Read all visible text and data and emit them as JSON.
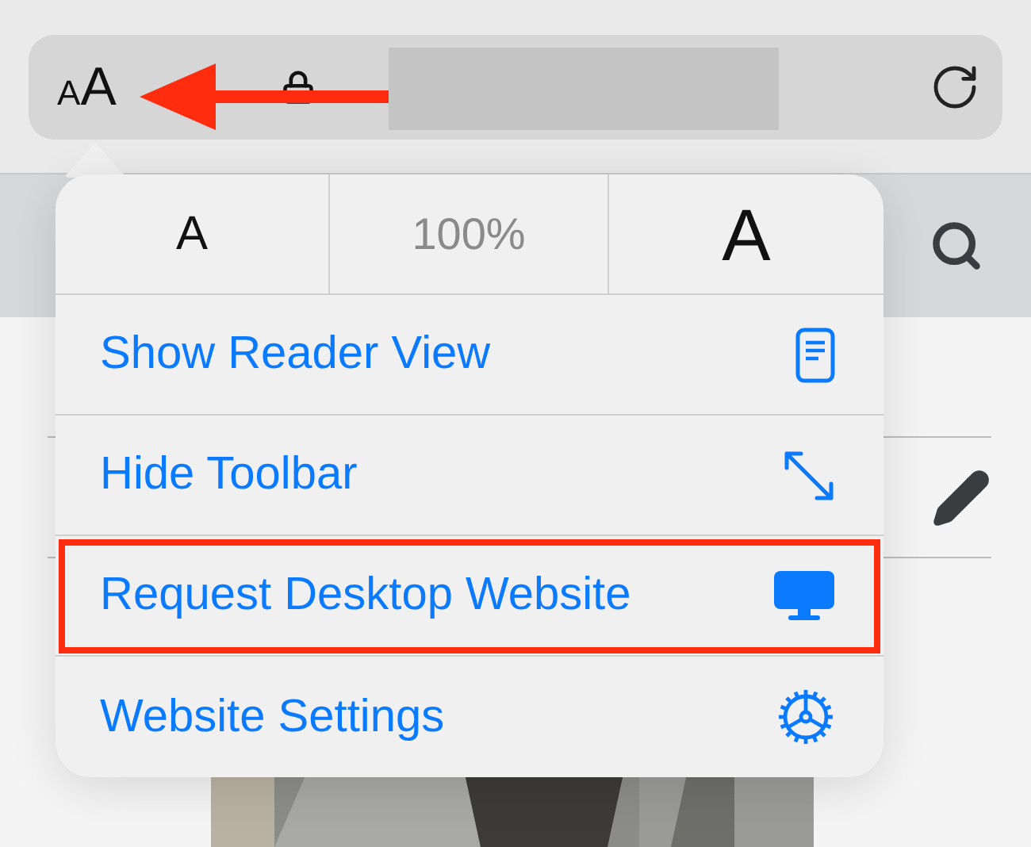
{
  "address_bar": {
    "text_size_letters": [
      "A",
      "A"
    ]
  },
  "text_size_row": [
    {
      "kind": "smaller",
      "label": "A"
    },
    {
      "kind": "zoom",
      "label": "100%"
    },
    {
      "kind": "larger",
      "label": "A"
    }
  ],
  "menu_items": [
    {
      "label": "Show Reader View",
      "kind": "reader",
      "highlighted": false
    },
    {
      "label": "Hide Toolbar",
      "kind": "expand",
      "highlighted": false
    },
    {
      "label": "Request Desktop Website",
      "kind": "desktop",
      "highlighted": true
    },
    {
      "label": "Website Settings",
      "kind": "settings",
      "highlighted": false
    }
  ]
}
